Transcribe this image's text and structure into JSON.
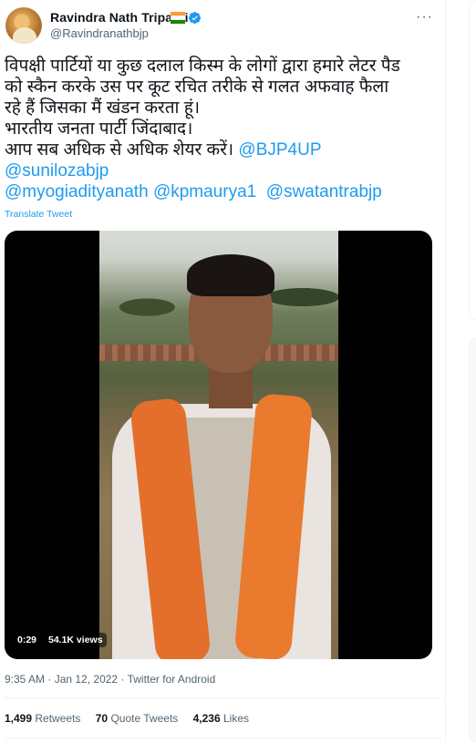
{
  "author": {
    "name": "Ravindra Nath Tripathi",
    "handle": "@Ravindranathbjp",
    "flag_icon": "india-flag-icon",
    "verified_icon": "verified-badge-icon"
  },
  "more_icon": "···",
  "tweet_text": {
    "line1": "विपक्षी पार्टियों या कुछ दलाल किस्म के लोगों द्वारा हमारे लेटर पैड",
    "line2": "को स्कैन करके उस पर कूट रचित तरीके से गलत अफवाह फैला",
    "line3": "रहे हैं जिसका मैं खंडन करता हूं।",
    "line4": " भारतीय जनता पार्टी जिंदाबाद।",
    "line5_text": "आप सब अधिक से अधिक शेयर करें। ",
    "mention_bjp4up": "@BJP4UP",
    "mention_sunilozabjp": "@sunilozabjp",
    "mention_myogiadityanath": "@myogiadityanath",
    "mention_kpmaurya1": "@kpmaurya1",
    "mention_swatantrabjp": "@swatantrabjp"
  },
  "translate_link": "Translate Tweet",
  "video": {
    "duration": "0:29",
    "views": "54.1K views"
  },
  "meta": {
    "time": "9:35 AM",
    "separator": " · ",
    "date": "Jan 12, 2022",
    "source": "Twitter for Android"
  },
  "stats": {
    "retweets_count": "1,499",
    "retweets_label": "Retweets",
    "quote_count": "70",
    "quote_label": "Quote Tweets",
    "likes_count": "4,236",
    "likes_label": "Likes"
  },
  "colors": {
    "accent": "#1d9bf0",
    "text": "#0f1419",
    "secondary": "#536471"
  }
}
